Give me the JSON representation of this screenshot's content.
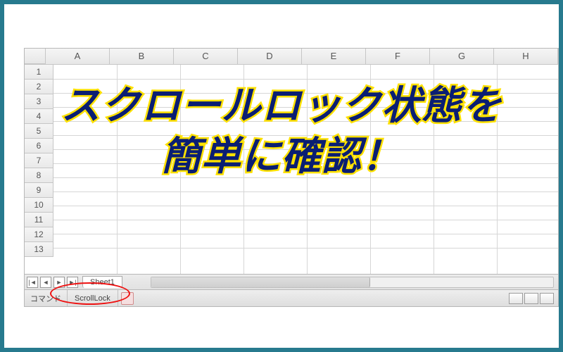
{
  "columns": [
    "A",
    "B",
    "C",
    "D",
    "E",
    "F",
    "G",
    "H"
  ],
  "rows": [
    "1",
    "2",
    "3",
    "4",
    "5",
    "6",
    "7",
    "8",
    "9",
    "10",
    "11",
    "12",
    "13"
  ],
  "tabbar": {
    "nav_first": "|◄",
    "nav_prev": "◄",
    "nav_next": "►",
    "nav_last": "►|",
    "sheet1_label": "Sheet1"
  },
  "status": {
    "mode_label": "コマンド",
    "scrolllock_label": "ScrollLock"
  },
  "overlay": {
    "line1": "スクロールロック状態を",
    "line2": "簡単に確認！"
  }
}
